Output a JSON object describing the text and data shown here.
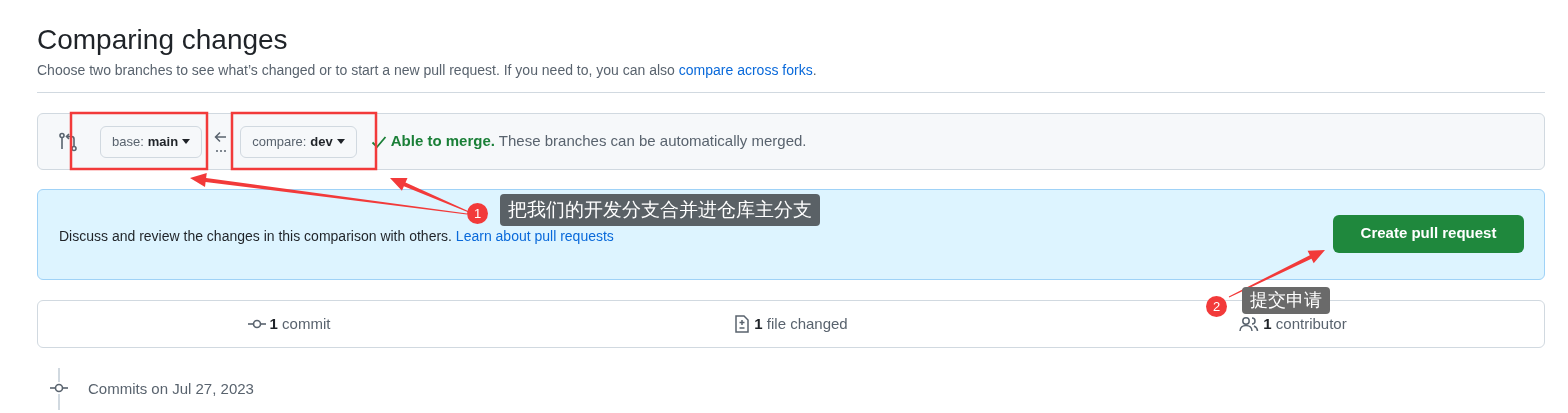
{
  "header": {
    "title": "Comparing changes",
    "subtitle": "Choose two branches to see what’s changed or to start a new pull request. If you need to, you can also ",
    "subtitle_link": "compare across forks",
    "subtitle_end": "."
  },
  "branch_bar": {
    "base": {
      "label": "base:",
      "value": "main"
    },
    "compare": {
      "label": "compare:",
      "value": "dev"
    },
    "status": "Able to merge.",
    "message": "These branches can be automatically merged."
  },
  "pr_box": {
    "text": "Discuss and review the changes in this comparison with others. ",
    "link": "Learn about pull requests",
    "button": "Create pull request"
  },
  "stats": [
    {
      "kind": "commit",
      "count": "1",
      "label": "commit"
    },
    {
      "kind": "file",
      "count": "1",
      "label": "file changed"
    },
    {
      "kind": "contributor",
      "count": "1",
      "label": "contributor"
    }
  ],
  "commits_heading": "Commits on Jul 27, 2023",
  "annotations": [
    {
      "number": "1",
      "text": "把我们的开发分支合并进仓库主分支"
    },
    {
      "number": "2",
      "text": "提交申请"
    }
  ]
}
